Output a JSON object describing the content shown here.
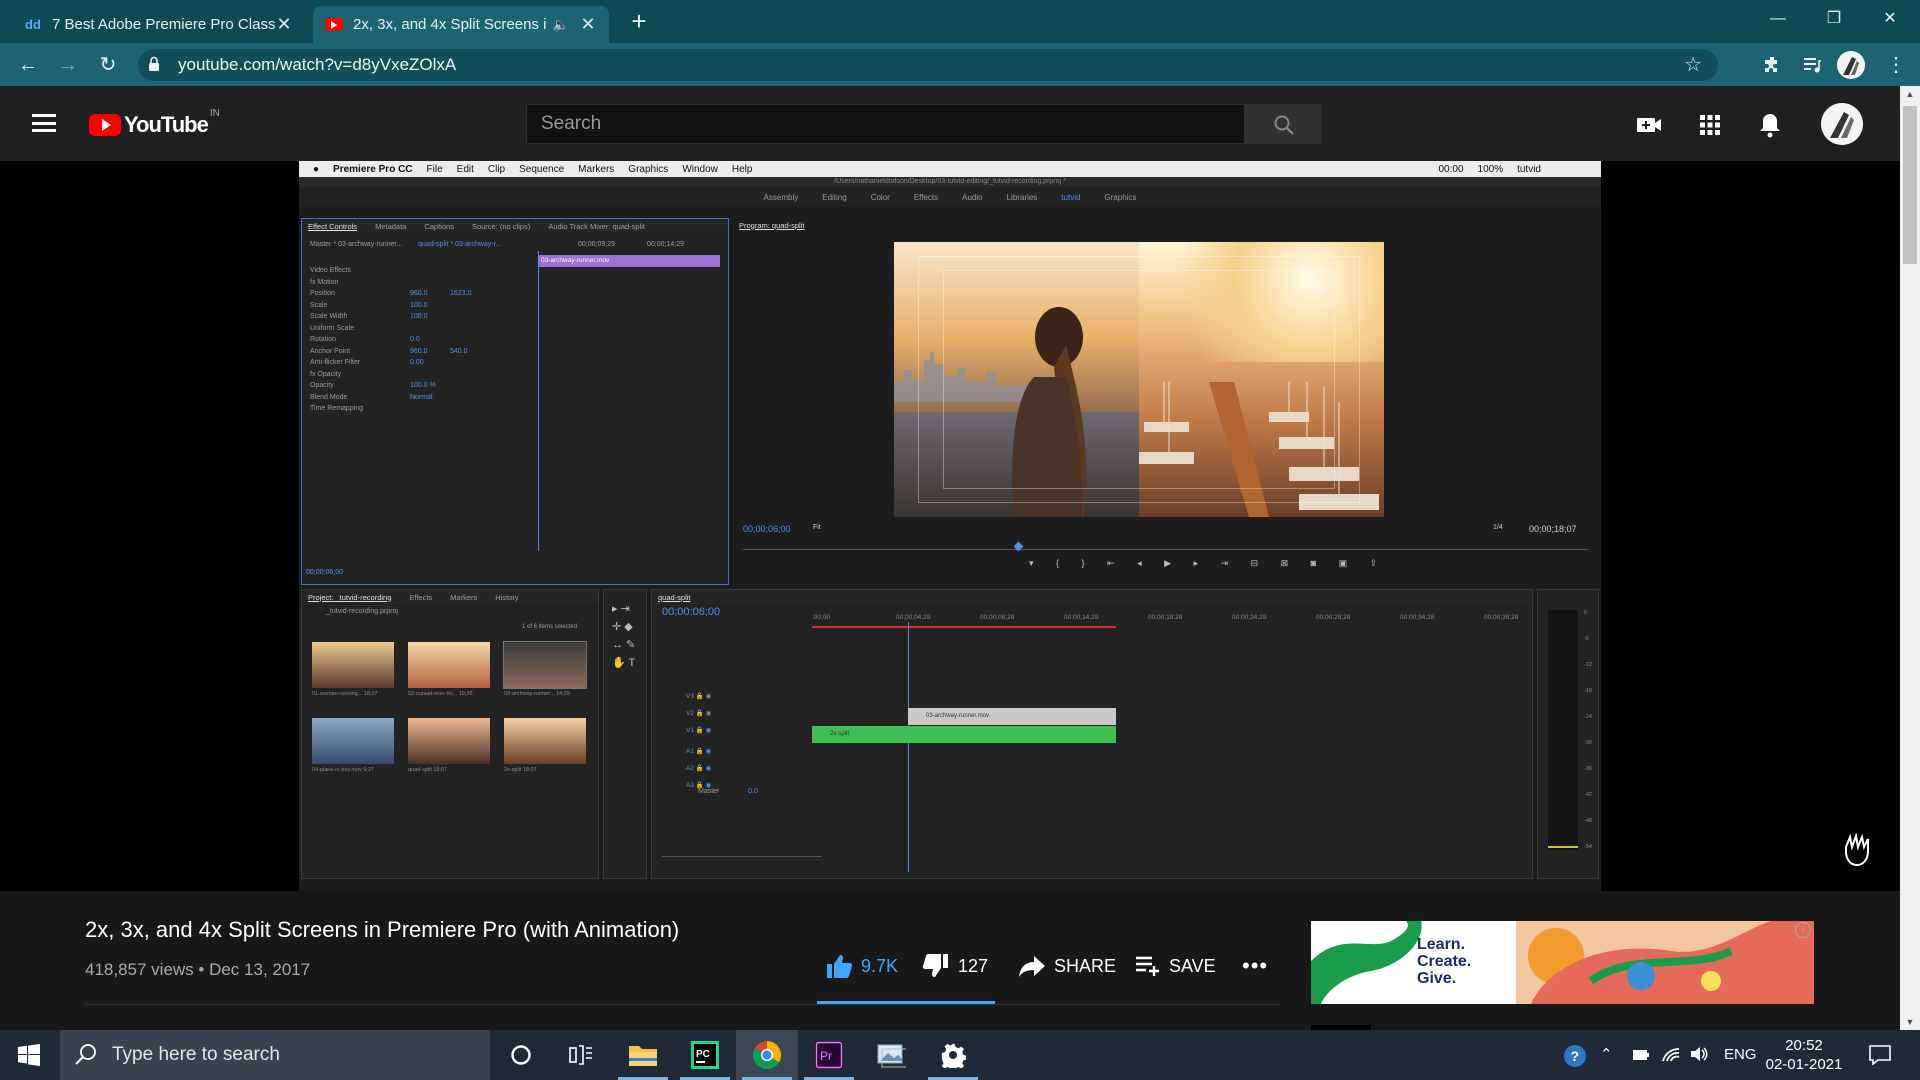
{
  "browser": {
    "tabs": [
      {
        "favicon": "dd",
        "title": "7 Best Adobe Premiere Pro Class",
        "close": "✕"
      },
      {
        "favicon": "youtube-favicon",
        "title": "2x, 3x, and 4x Split Screens in",
        "close": "✕"
      }
    ],
    "new_tab": "+",
    "window_controls": {
      "minimize": "—",
      "restore": "❐",
      "close": "✕"
    },
    "url": "youtube.com/watch?v=d8yVxeZOlxA"
  },
  "youtube": {
    "logo_text": "YouTube",
    "country": "IN",
    "search_placeholder": "Search"
  },
  "premiere": {
    "menu": [
      "Premiere Pro CC",
      "File",
      "Edit",
      "Clip",
      "Sequence",
      "Markers",
      "Graphics",
      "Window",
      "Help"
    ],
    "menu_status": [
      "00:00",
      "100%",
      "tutvid"
    ],
    "path": "/Users/nathanieldodson/Desktop/03-tutvid-editing/_tutvid-recording.prproj *",
    "workspaces": [
      "Assembly",
      "Editing",
      "Color",
      "Effects",
      "Audio",
      "Libraries",
      "tutvid",
      "Graphics"
    ],
    "active_workspace": "tutvid",
    "effect_controls_tabs": [
      "Effect Controls",
      "Metadata",
      "Captions",
      "Source: (no clips)",
      "Audio Track Mixer: quad-split"
    ],
    "ec_master": "Master * 03-archway-runner...",
    "ec_sequence": "quad-split * 03-archway-r...",
    "ec_times": [
      "00;00;09;29",
      "00;00;14;29"
    ],
    "ec_clip": "03-archway-runner.mov",
    "ec_rows": [
      {
        "label": "Video Effects",
        "value": "",
        "value2": ""
      },
      {
        "label": "fx  Motion",
        "value": "",
        "value2": ""
      },
      {
        "label": "Position",
        "value": "960.0",
        "value2": "1623.0"
      },
      {
        "label": "Scale",
        "value": "100.0",
        "value2": ""
      },
      {
        "label": "Scale Width",
        "value": "100.0",
        "value2": ""
      },
      {
        "label": "Uniform Scale",
        "value": "",
        "value2": ""
      },
      {
        "label": "Rotation",
        "value": "0.0",
        "value2": ""
      },
      {
        "label": "Anchor Point",
        "value": "960.0",
        "value2": "540.0"
      },
      {
        "label": "Anti-flicker Filter",
        "value": "0.00",
        "value2": ""
      },
      {
        "label": "fx  Opacity",
        "value": "",
        "value2": ""
      },
      {
        "label": "Opacity",
        "value": "100.0 %",
        "value2": ""
      },
      {
        "label": "Blend Mode",
        "value": "Normal",
        "value2": ""
      },
      {
        "label": "Time Remapping",
        "value": "",
        "value2": ""
      }
    ],
    "ec_timecode": "00;00;06;00",
    "program_title": "Program: quad-split",
    "program_timecode": "00;00;06;00",
    "program_fit": "Fit",
    "program_quality": "1/4",
    "program_duration": "00;00;18;07",
    "project_tabs": [
      "Project: _tutvid-recording",
      "Effects",
      "Markers",
      "History"
    ],
    "project_file": "_tutvid-recording.prproj",
    "project_selection": "1 of 6 items selected",
    "project_items": [
      {
        "name": "01-woman-running...",
        "dur": "18;07"
      },
      {
        "name": "02-sunset-over-bo...",
        "dur": "19;26"
      },
      {
        "name": "03-archway-runner...",
        "dur": "14;29"
      },
      {
        "name": "04-plane-in-bay.mov",
        "dur": "9;27"
      },
      {
        "name": "quad-split",
        "dur": "18;07"
      },
      {
        "name": "2x-split",
        "dur": "18;07"
      }
    ],
    "timeline_title": "quad-split",
    "timeline_timecode": "00;00;06;00",
    "ruler": [
      ":00;00",
      "00;00;04;29",
      "00;00;09;29",
      "00;00;14;29",
      "00;00;19;29",
      "00;00;24;29",
      "00;00;29;29",
      "00;00;34;28",
      "00;00;39;29"
    ],
    "tracks_video": [
      "V3",
      "V2",
      "V1"
    ],
    "tracks_audio": [
      "A1",
      "A2",
      "A3"
    ],
    "master_label": "Master",
    "master_value": "0.0",
    "clip_v2": "03-archway-runner.mov",
    "clip_v1": "2x-split",
    "meter_scale": [
      "0",
      "-6",
      "-12",
      "-18",
      "-24",
      "-30",
      "-36",
      "-42",
      "-48",
      "-54"
    ]
  },
  "video": {
    "title": "2x, 3x, and 4x Split Screens in Premiere Pro (with Animation)",
    "meta": "418,857 views • Dec 13, 2017",
    "likes": "9.7K",
    "dislikes": "127",
    "share": "SHARE",
    "save": "SAVE",
    "more": "•••",
    "like_ratio": 0.987
  },
  "ad": {
    "text_line1": "Learn.",
    "text_line2": "Create.",
    "text_line3": "Give.",
    "info": "i"
  },
  "taskbar": {
    "search_placeholder": "Type here to search",
    "language": "ENG",
    "time": "20:52",
    "date": "02-01-2021"
  },
  "colors": {
    "chrome_tabstrip": "#0e4a52",
    "chrome_toolbar": "#1c6570",
    "youtube_red": "#ff0000",
    "link_blue": "#3ea6ff",
    "premiere_blue": "#4f8fe8",
    "clip_purple": "#9e6fd6",
    "clip_green": "#40c050"
  }
}
